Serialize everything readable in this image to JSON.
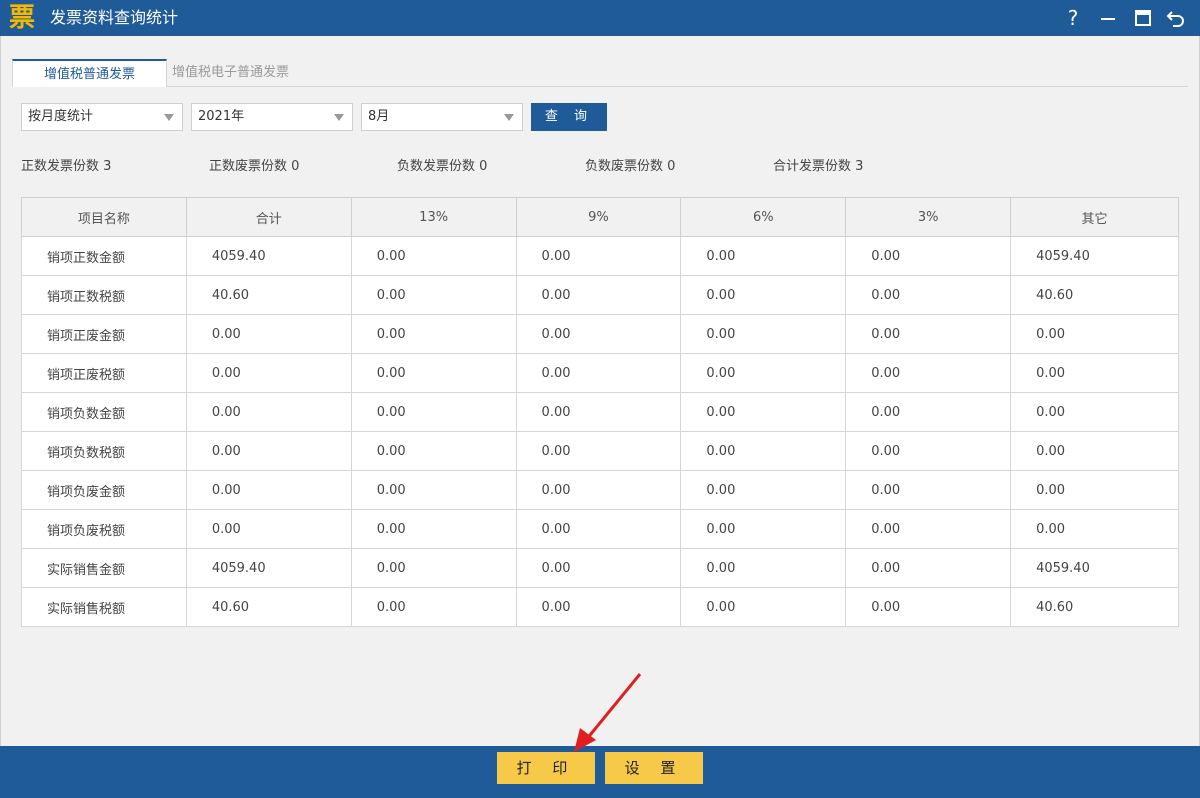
{
  "window": {
    "logo_char": "票",
    "title": "发票资料查询统计",
    "help_label": "?"
  },
  "tabs": [
    {
      "label": "增值税普通发票",
      "active": true
    },
    {
      "label": "增值税电子普通发票",
      "active": false
    }
  ],
  "filters": {
    "mode": "按月度统计",
    "year": "2021年",
    "month": "8月",
    "query_label": "查 询"
  },
  "stats": [
    {
      "label": "正数发票份数 3"
    },
    {
      "label": "正数废票份数 0"
    },
    {
      "label": "负数发票份数 0"
    },
    {
      "label": "负数废票份数 0"
    },
    {
      "label": "合计发票份数 3"
    }
  ],
  "table": {
    "headers": [
      "项目名称",
      "合计",
      "13%",
      "9%",
      "6%",
      "3%",
      "其它"
    ],
    "rows": [
      [
        "销项正数金额",
        "4059.40",
        "0.00",
        "0.00",
        "0.00",
        "0.00",
        "4059.40"
      ],
      [
        "销项正数税额",
        "40.60",
        "0.00",
        "0.00",
        "0.00",
        "0.00",
        "40.60"
      ],
      [
        "销项正废金额",
        "0.00",
        "0.00",
        "0.00",
        "0.00",
        "0.00",
        "0.00"
      ],
      [
        "销项正废税额",
        "0.00",
        "0.00",
        "0.00",
        "0.00",
        "0.00",
        "0.00"
      ],
      [
        "销项负数金额",
        "0.00",
        "0.00",
        "0.00",
        "0.00",
        "0.00",
        "0.00"
      ],
      [
        "销项负数税额",
        "0.00",
        "0.00",
        "0.00",
        "0.00",
        "0.00",
        "0.00"
      ],
      [
        "销项负废金额",
        "0.00",
        "0.00",
        "0.00",
        "0.00",
        "0.00",
        "0.00"
      ],
      [
        "销项负废税额",
        "0.00",
        "0.00",
        "0.00",
        "0.00",
        "0.00",
        "0.00"
      ],
      [
        "实际销售金额",
        "4059.40",
        "0.00",
        "0.00",
        "0.00",
        "0.00",
        "4059.40"
      ],
      [
        "实际销售税额",
        "40.60",
        "0.00",
        "0.00",
        "0.00",
        "0.00",
        "40.60"
      ]
    ]
  },
  "footer": {
    "print_label": "打 印",
    "settings_label": "设 置"
  },
  "colors": {
    "brand": "#1f5a99",
    "button": "#f7c948",
    "annotation_arrow": "#e02020"
  }
}
